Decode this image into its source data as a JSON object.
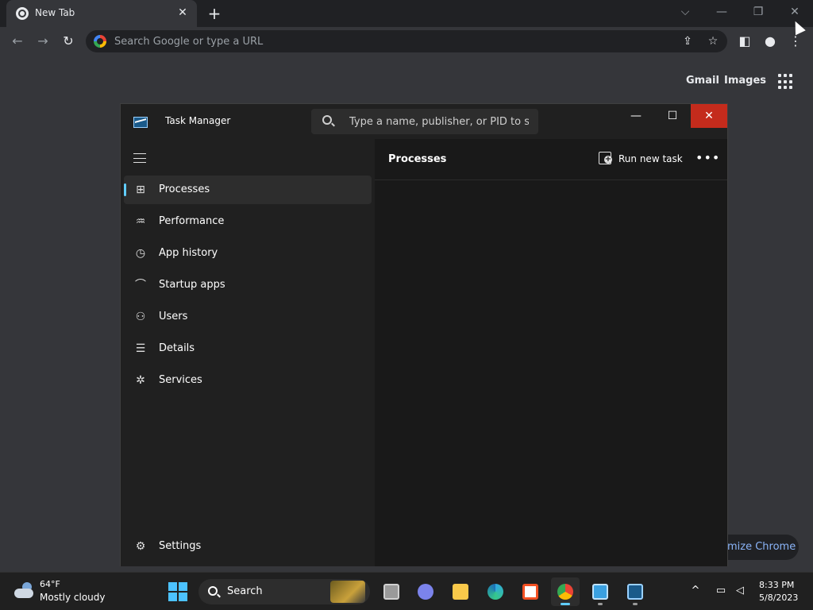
{
  "browser": {
    "tab_title": "New Tab",
    "omnibox_placeholder": "Search Google or type a URL",
    "ntp_links": {
      "gmail": "Gmail",
      "images": "Images"
    },
    "customize_label": "mize Chrome"
  },
  "task_manager": {
    "title": "Task Manager",
    "search_placeholder": "Type a name, publisher, or PID to s...",
    "nav": [
      {
        "label": "Processes",
        "icon": "processes-grid-icon"
      },
      {
        "label": "Performance",
        "icon": "performance-pulse-icon"
      },
      {
        "label": "App history",
        "icon": "history-clock-icon"
      },
      {
        "label": "Startup apps",
        "icon": "startup-gauge-icon"
      },
      {
        "label": "Users",
        "icon": "users-icon"
      },
      {
        "label": "Details",
        "icon": "details-list-icon"
      },
      {
        "label": "Services",
        "icon": "services-puzzle-icon"
      }
    ],
    "settings_label": "Settings",
    "content_title": "Processes",
    "run_new_task_label": "Run new task",
    "colors": {
      "accent": "#60cdff",
      "close_button": "#c42b1c"
    }
  },
  "taskbar": {
    "weather_temp": "64°F",
    "weather_condition": "Mostly cloudy",
    "search_label": "Search",
    "clock_time": "8:33 PM",
    "clock_date": "5/8/2023",
    "apps": [
      "task-view",
      "teams-chat",
      "file-explorer",
      "edge",
      "microsoft-store",
      "chrome",
      "remote-desktop",
      "task-manager"
    ]
  }
}
